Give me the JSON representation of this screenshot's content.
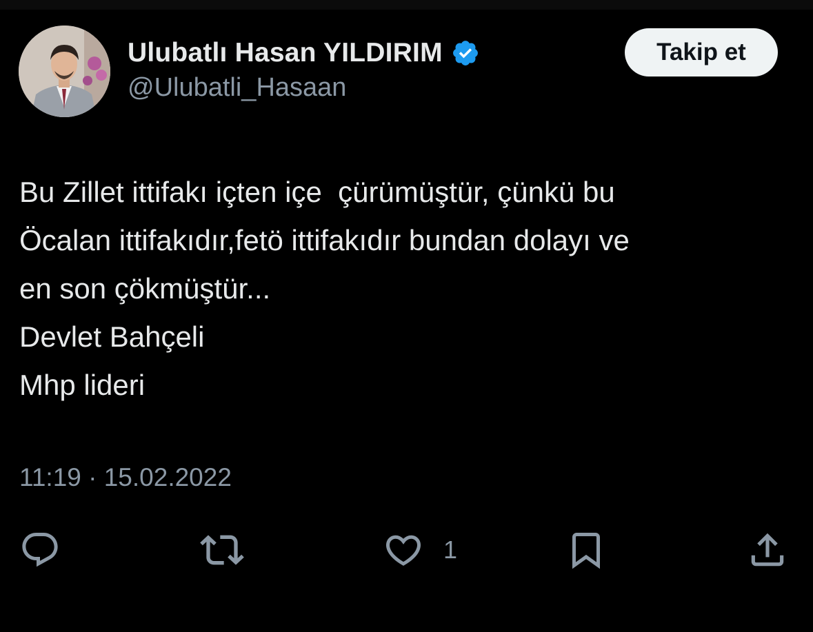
{
  "user": {
    "display_name": "Ulubatlı Hasan YILDIRIM",
    "handle": "@Ulubatli_Hasaan",
    "verified_icon": "verified-badge-icon",
    "verified_color": "#1d9bf0",
    "avatar": "profile-photo"
  },
  "follow_button": {
    "label": "Takip et"
  },
  "tweet": {
    "lines": [
      "Bu Zillet ittifakı içten içe  çürümüştür, çünkü bu",
      "Öcalan ittifakıdır,fetö ittifakıdır bundan dolayı ve",
      "en son çökmüştür...",
      "Devlet Bahçeli",
      "Mhp lideri"
    ],
    "timestamp": "11:19 · 15.02.2022"
  },
  "actions": {
    "reply_icon": "reply-icon",
    "retweet_icon": "retweet-icon",
    "like_icon": "heart-icon",
    "like_count": "1",
    "bookmark_icon": "bookmark-icon",
    "share_icon": "share-icon"
  },
  "colors": {
    "background": "#000000",
    "text": "#e7e9ea",
    "secondary_text": "#8b98a5",
    "button_bg": "#eff3f4"
  }
}
